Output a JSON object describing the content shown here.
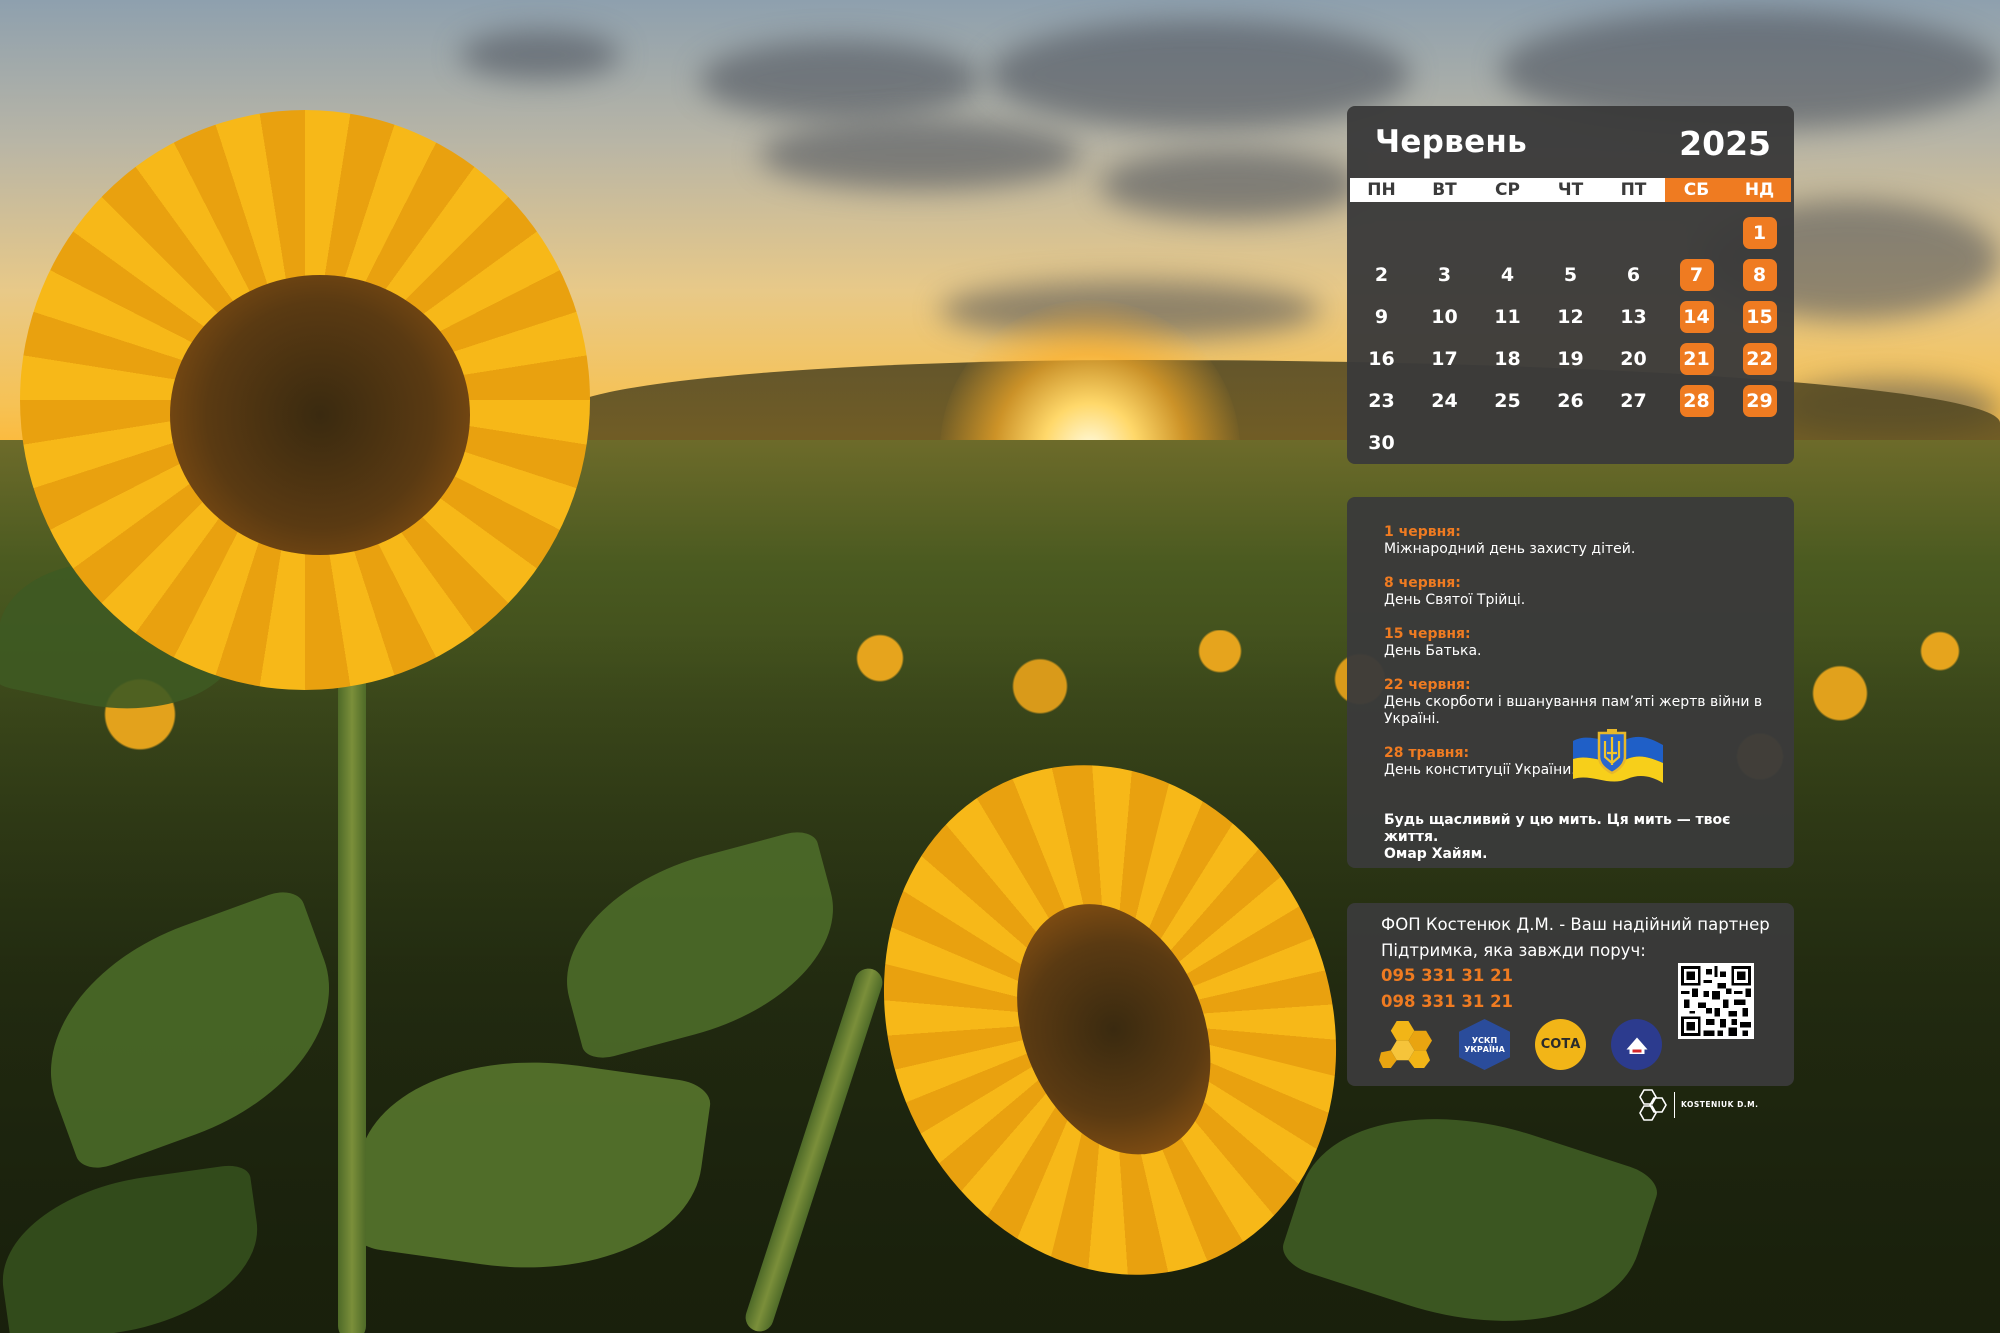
{
  "calendar": {
    "month": "Червень",
    "year": "2025",
    "weekdays": [
      "ПН",
      "ВТ",
      "СР",
      "ЧТ",
      "ПТ",
      "СБ",
      "НД"
    ],
    "weekend_color": "#ef7b21",
    "weeks": [
      [
        "",
        "",
        "",
        "",
        "",
        "",
        "1"
      ],
      [
        "2",
        "3",
        "4",
        "5",
        "6",
        "7",
        "8"
      ],
      [
        "9",
        "10",
        "11",
        "12",
        "13",
        "14",
        "15"
      ],
      [
        "16",
        "17",
        "18",
        "19",
        "20",
        "21",
        "22"
      ],
      [
        "23",
        "24",
        "25",
        "26",
        "27",
        "28",
        "29"
      ],
      [
        "30",
        "",
        "",
        "",
        "",
        "",
        ""
      ]
    ]
  },
  "events": [
    {
      "date": "1 червня:",
      "text": "Міжнародний день захисту дітей."
    },
    {
      "date": "8 червня:",
      "text": "День Святої Трійці."
    },
    {
      "date": "15 червня:",
      "text": "День Батька."
    },
    {
      "date": "22 червня:",
      "text": "День скорботи і вшанування пам’яті жертв війни в Україні."
    },
    {
      "date": "28 травня:",
      "text": "День конституції України."
    }
  ],
  "quote": {
    "text": "Будь щасливий у цю мить. Ця мить — твоє життя.",
    "author": "Омар Хайям."
  },
  "partner": {
    "title": "ФОП Костенюк Д.М. - Ваш надійний партнер",
    "support": "Підтримка, яка завжди поруч:",
    "phones": [
      "095 331 31 21",
      "098 331 31 21"
    ],
    "logos": {
      "uskp": "УСКП УКРАЇНА",
      "sota": "СОТА"
    }
  },
  "brand": {
    "name": "KOSTENIUK D.M."
  },
  "colors": {
    "accent": "#ef7b21",
    "panel": "#3a3a3a",
    "text": "#ffffff"
  },
  "icons": [
    "coat-of-arms-flag-icon",
    "qr-code-icon",
    "honeycomb-logo-icon",
    "uskp-logo-icon",
    "sota-logo-icon",
    "ru-logo-icon",
    "brand-hex-logo-icon"
  ]
}
